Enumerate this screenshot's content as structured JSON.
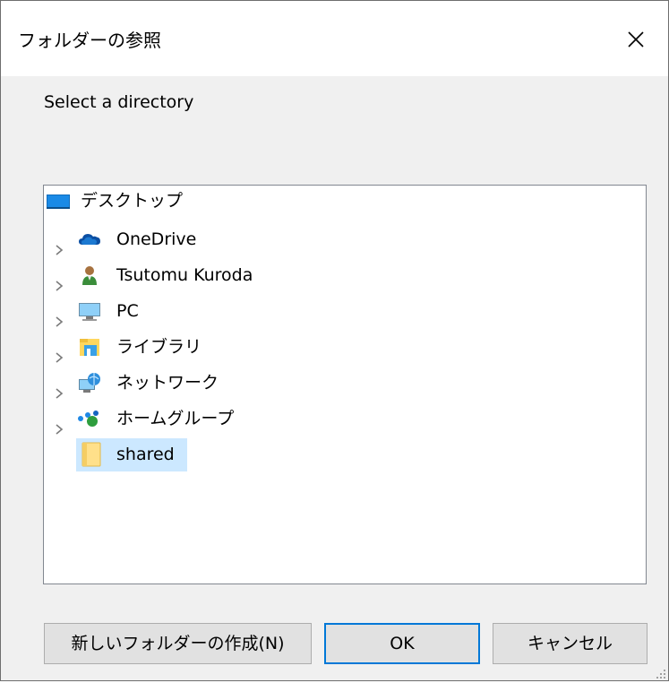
{
  "window": {
    "title": "フォルダーの参照",
    "close_icon": "close-icon"
  },
  "prompt": "Select a directory",
  "tree": {
    "items": [
      {
        "label": "デスクトップ",
        "icon": "desktop-icon",
        "expandable": false,
        "selected": false
      },
      {
        "label": "OneDrive",
        "icon": "onedrive-cloud-icon",
        "expandable": true,
        "selected": false
      },
      {
        "label": "Tsutomu Kuroda",
        "icon": "user-icon",
        "expandable": true,
        "selected": false
      },
      {
        "label": "PC",
        "icon": "computer-icon",
        "expandable": true,
        "selected": false
      },
      {
        "label": "ライブラリ",
        "icon": "library-icon",
        "expandable": true,
        "selected": false
      },
      {
        "label": "ネットワーク",
        "icon": "network-icon",
        "expandable": true,
        "selected": false
      },
      {
        "label": "ホームグループ",
        "icon": "homegroup-icon",
        "expandable": true,
        "selected": false
      },
      {
        "label": "shared",
        "icon": "folder-icon",
        "expandable": false,
        "selected": true
      }
    ]
  },
  "buttons": {
    "new_folder": "新しいフォルダーの作成(N)",
    "ok": "OK",
    "cancel": "キャンセル"
  },
  "colors": {
    "selection": "#cce8ff",
    "accent": "#0078d7",
    "button_face": "#e1e1e1"
  }
}
